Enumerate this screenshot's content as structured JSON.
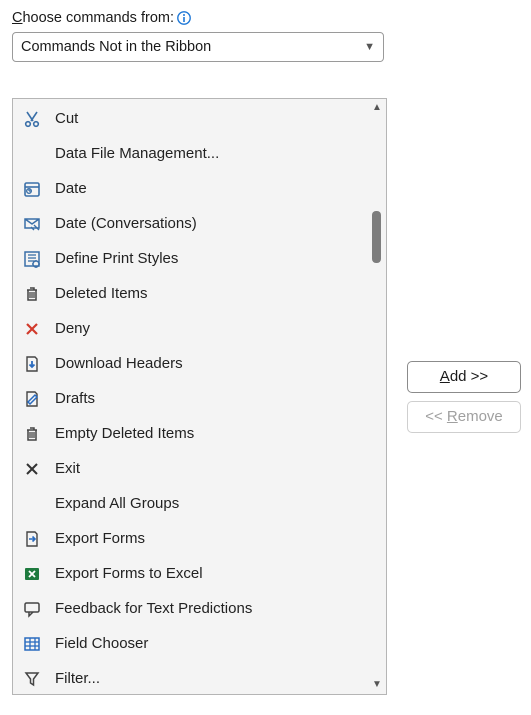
{
  "label": {
    "prefix_underlined": "C",
    "rest": "hoose commands from:"
  },
  "dropdown": {
    "value": "Commands Not in the Ribbon"
  },
  "commands": [
    {
      "icon": "cut-icon",
      "label": "Cut"
    },
    {
      "icon": "",
      "label": "Data File Management..."
    },
    {
      "icon": "date-icon",
      "label": "Date"
    },
    {
      "icon": "date-conv-icon",
      "label": "Date (Conversations)"
    },
    {
      "icon": "print-styles-icon",
      "label": "Define Print Styles"
    },
    {
      "icon": "trash-icon",
      "label": "Deleted Items"
    },
    {
      "icon": "deny-icon",
      "label": "Deny"
    },
    {
      "icon": "download-icon",
      "label": "Download Headers"
    },
    {
      "icon": "drafts-icon",
      "label": "Drafts"
    },
    {
      "icon": "trash-icon",
      "label": "Empty Deleted Items"
    },
    {
      "icon": "exit-icon",
      "label": "Exit"
    },
    {
      "icon": "",
      "label": "Expand All Groups"
    },
    {
      "icon": "export-icon",
      "label": "Export Forms"
    },
    {
      "icon": "excel-icon",
      "label": "Export Forms to Excel"
    },
    {
      "icon": "feedback-icon",
      "label": "Feedback for Text Predictions"
    },
    {
      "icon": "field-chooser-icon",
      "label": "Field Chooser"
    },
    {
      "icon": "filter-icon",
      "label": "Filter..."
    }
  ],
  "buttons": {
    "add": {
      "underlined": "A",
      "rest": "dd >>"
    },
    "remove": {
      "prefix": "<< ",
      "underlined": "R",
      "rest": "emove"
    }
  }
}
